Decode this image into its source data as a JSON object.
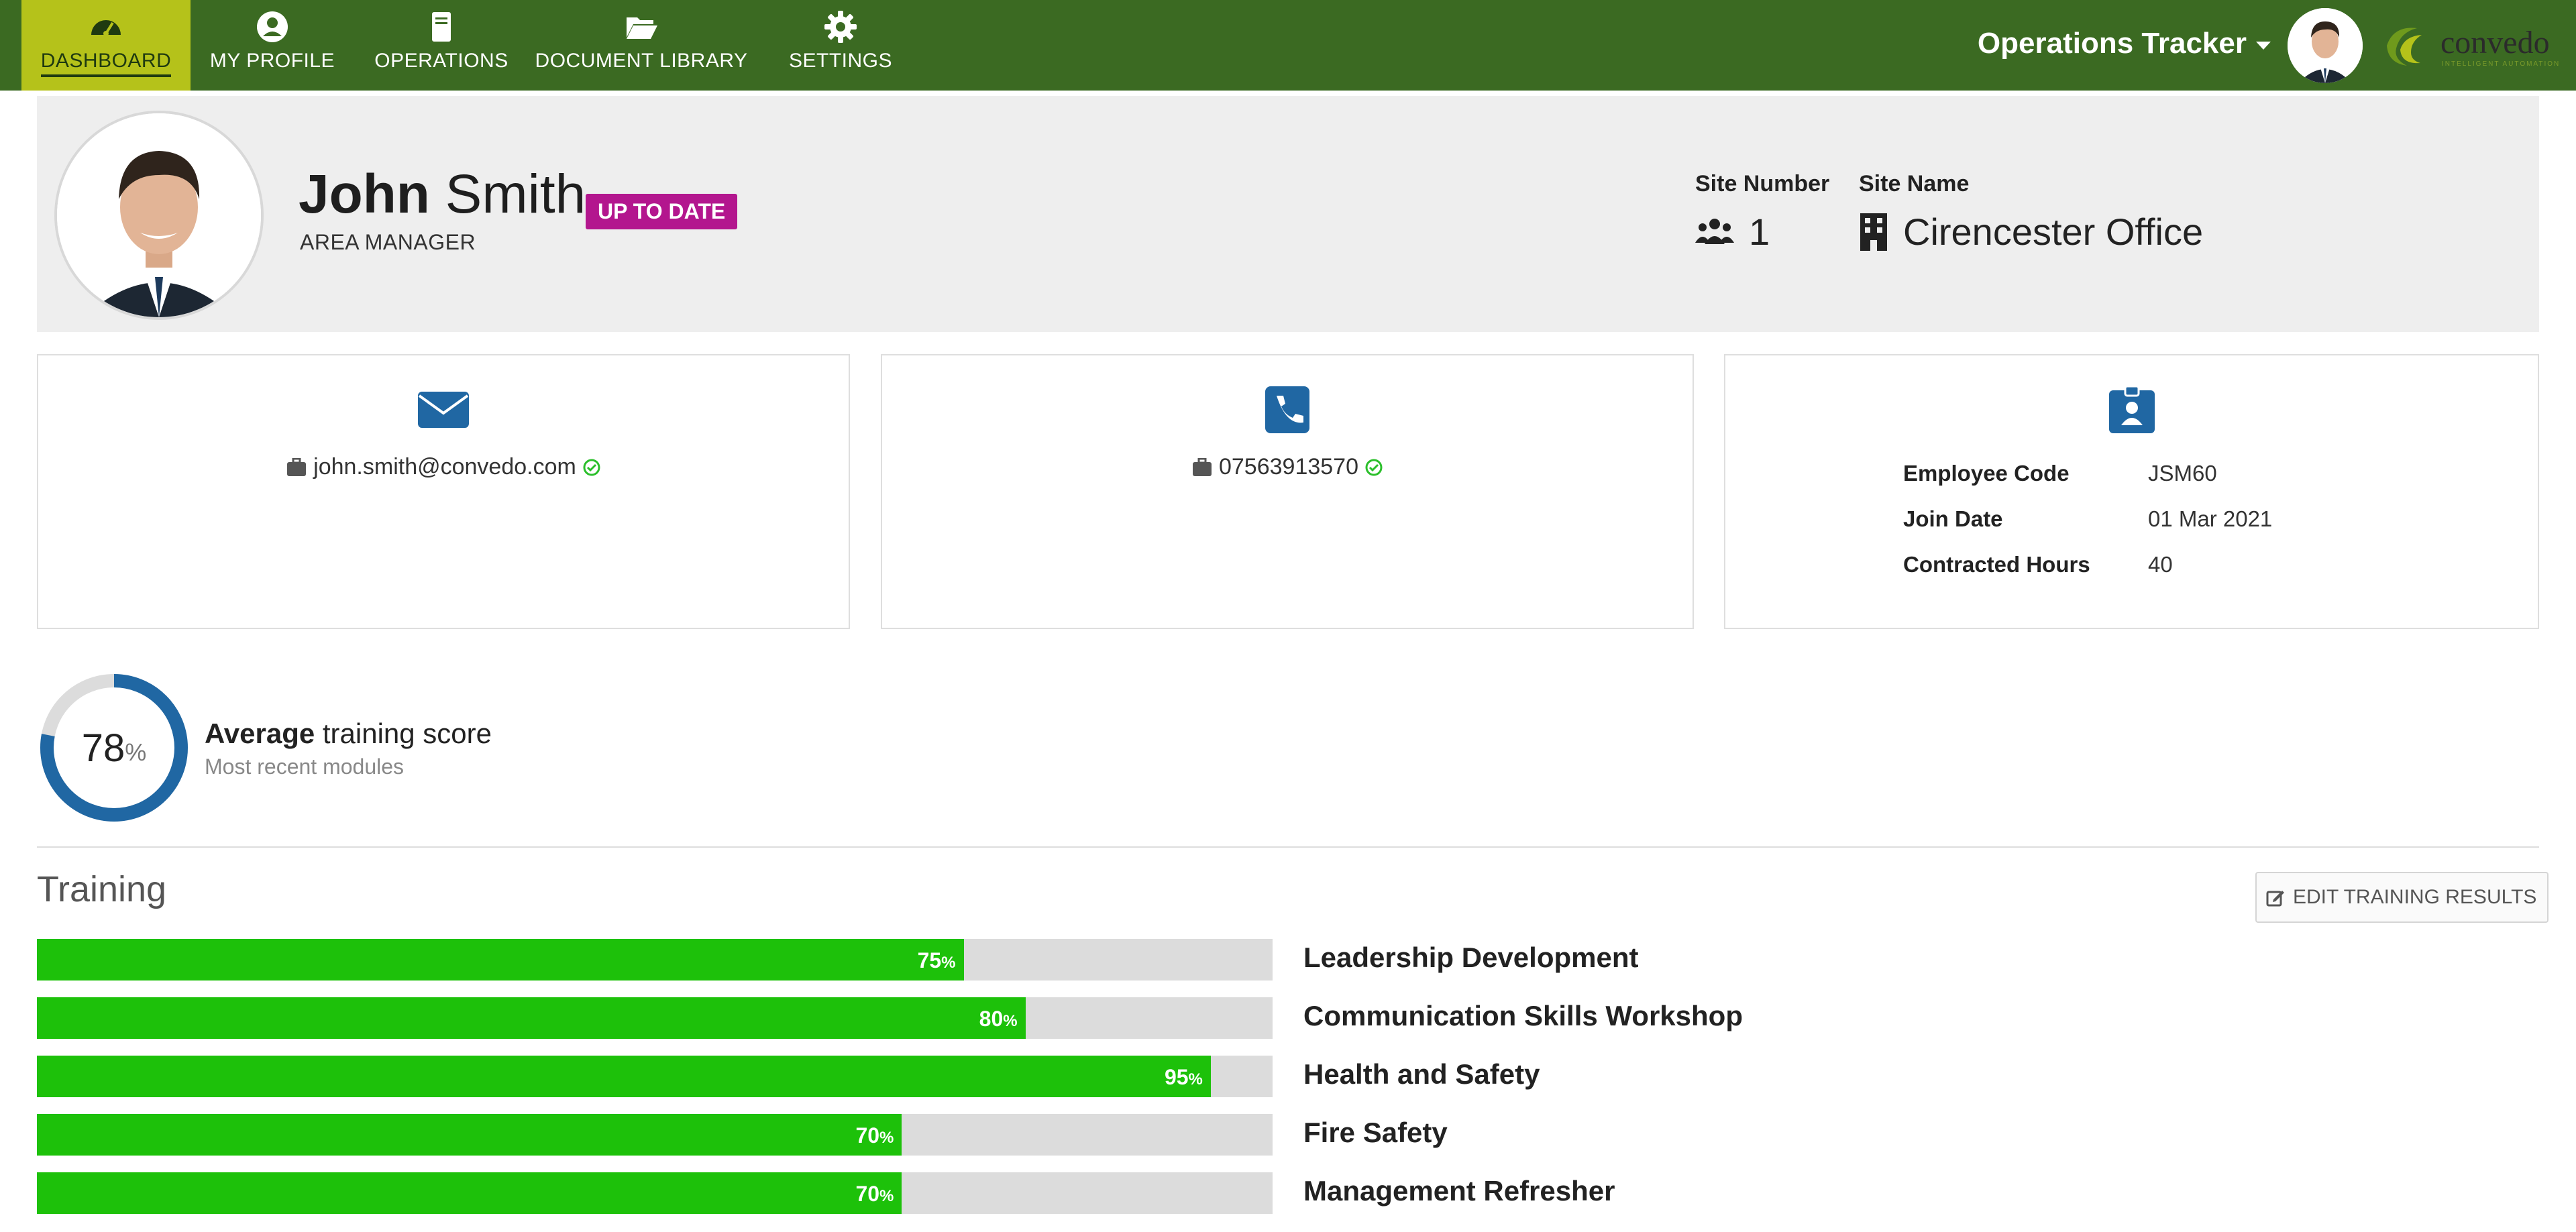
{
  "nav": {
    "items": [
      {
        "label": "DASHBOARD",
        "icon": "dashboard-gauge-icon",
        "active": true
      },
      {
        "label": "MY PROFILE",
        "icon": "user-circle-icon",
        "active": false
      },
      {
        "label": "OPERATIONS",
        "icon": "book-icon",
        "active": false
      },
      {
        "label": "DOCUMENT LIBRARY",
        "icon": "folder-open-icon",
        "active": false
      },
      {
        "label": "SETTINGS",
        "icon": "gear-icon",
        "active": false
      }
    ],
    "tracker_label": "Operations Tracker",
    "logo_text": "convedo",
    "logo_tagline": "INTELLIGENT AUTOMATION"
  },
  "profile": {
    "first_name": "John",
    "last_name": "Smith",
    "role": "AREA MANAGER",
    "status_badge": "UP TO DATE",
    "site_number_label": "Site Number",
    "site_number": "1",
    "site_name_label": "Site Name",
    "site_name": "Cirencester Office"
  },
  "contact": {
    "email": "john.smith@convedo.com",
    "phone": "07563913570"
  },
  "employee": {
    "rows": [
      {
        "key": "Employee Code",
        "value": "JSM60"
      },
      {
        "key": "Join Date",
        "value": "01 Mar 2021"
      },
      {
        "key": "Contracted Hours",
        "value": "40"
      }
    ]
  },
  "score": {
    "value": 78,
    "value_text": "78",
    "unit": "%",
    "title_bold": "Average",
    "title_rest": " training score",
    "subtitle": "Most recent modules"
  },
  "training": {
    "title": "Training",
    "edit_button": "EDIT TRAINING RESULTS",
    "modules": [
      {
        "name": "Leadership Development",
        "value": 75,
        "value_text": "75"
      },
      {
        "name": "Communication Skills Workshop",
        "value": 80,
        "value_text": "80"
      },
      {
        "name": "Health and Safety",
        "value": 95,
        "value_text": "95"
      },
      {
        "name": "Fire Safety",
        "value": 70,
        "value_text": "70"
      },
      {
        "name": "Management Refresher",
        "value": 70,
        "value_text": "70"
      }
    ],
    "unit": "%"
  },
  "colors": {
    "topbar": "#3b6a22",
    "active_nav": "#b5c21a",
    "badge": "#b3168e",
    "accent_blue": "#2067a3",
    "bar_fill": "#1dc10a",
    "bar_track": "#dcdcdc"
  }
}
